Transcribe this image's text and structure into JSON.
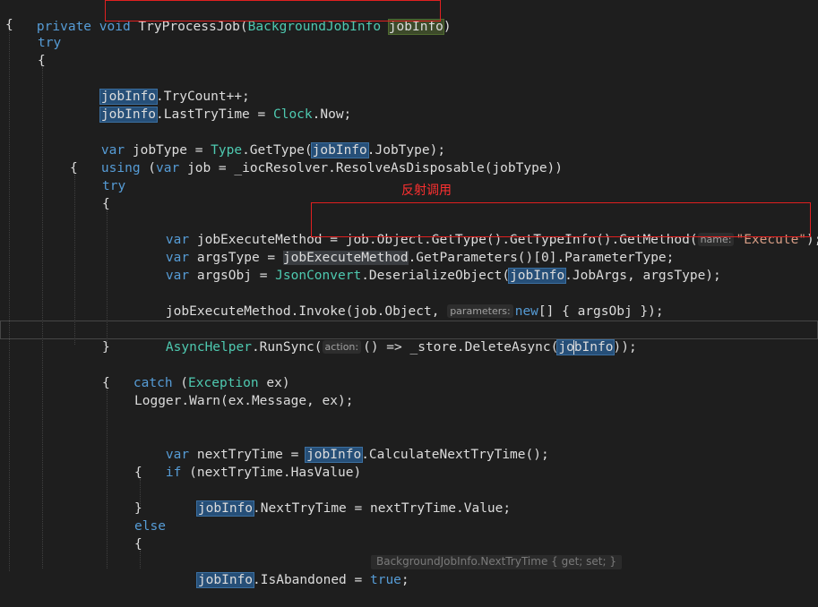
{
  "annotation": "反射调用",
  "code": {
    "l1": {
      "private": "private",
      "void": "void",
      "method": "TryProcessJob",
      "paren_open": "(",
      "param_type": "BackgroundJobInfo",
      "param_name": "jobInfo",
      "paren_close": ")"
    },
    "l2": {
      "text": "{"
    },
    "l3": {
      "try": "try"
    },
    "l4": {
      "text": "{"
    },
    "l5": {
      "var": "jobInfo",
      "rest": ".TryCount++;"
    },
    "l6": {
      "var": "jobInfo",
      "mid": ".LastTryTime = ",
      "type": "Clock",
      "rest": ".Now;"
    },
    "l7": {
      "kw": "var",
      "mid": " jobType = ",
      "type": "Type",
      "mid2": ".GetType(",
      "var": "jobInfo",
      "rest": ".JobType);"
    },
    "l8": {
      "kw": "using",
      "mid": " (",
      "kw2": "var",
      "rest": " job = _iocResolver.ResolveAsDisposable(jobType))"
    },
    "l9": {
      "text": "{"
    },
    "l10": {
      "try": "try"
    },
    "l11": {
      "text": "{"
    },
    "l12": {
      "kw": "var",
      "mid": " jobExecuteMethod = job.Object.GetType().GetTypeInfo().GetMethod(",
      "hint": "name:",
      "str": "\"Execute\"",
      "rest": ");"
    },
    "l13": {
      "kw": "var",
      "mid": " argsType = ",
      "var": "jobExecuteMethod",
      "rest": ".GetParameters()[0].ParameterType;"
    },
    "l14": {
      "kw": "var",
      "mid": " argsObj = ",
      "type": "JsonConvert",
      "mid2": ".DeserializeObject(",
      "var": "jobInfo",
      "rest": ".JobArgs, argsType);"
    },
    "l15": {
      "mid": "jobExecuteMethod.Invoke(job.Object, ",
      "hint": "parameters:",
      "kw": "new",
      "rest": "[] { argsObj });"
    },
    "l16": {
      "type": "AsyncHelper",
      "mid": ".RunSync(",
      "hint": "action:",
      "mid2": "() => _store.DeleteAsync(",
      "var_a": "jo",
      "var_b": "bInfo",
      "rest": "));"
    },
    "l17": {
      "text": "}"
    },
    "l18": {
      "catch": "catch",
      "mid": " (",
      "type": "Exception",
      "rest": " ex)"
    },
    "l19": {
      "text": "{"
    },
    "l20": {
      "text": "Logger.Warn(ex.Message, ex);"
    },
    "l21": {
      "kw": "var",
      "mid": " nextTryTime = ",
      "var": "jobInfo",
      "rest": ".CalculateNextTryTime();"
    },
    "l22": {
      "kw": "if",
      "rest": " (nextTryTime.HasValue)"
    },
    "l23": {
      "text": "{"
    },
    "l24": {
      "var": "jobInfo",
      "rest": ".NextTryTime = nextTryTime.Value;"
    },
    "l25": {
      "text": "}"
    },
    "l26": {
      "else": "else"
    },
    "l27": {
      "text": "{"
    },
    "l28": {
      "var": "jobInfo",
      "mid": ".IsAbandoned = ",
      "kw": "true",
      "rest": ";"
    }
  },
  "tooltip_ghost": "BackgroundJobInfo.NextTryTime { get; set; }",
  "colors": {
    "background": "#1e1e1e",
    "keyword": "#569cd6",
    "type": "#4ec9b0",
    "string": "#d69d85",
    "highlight": "#264f78",
    "annotation": "#ff3030"
  }
}
